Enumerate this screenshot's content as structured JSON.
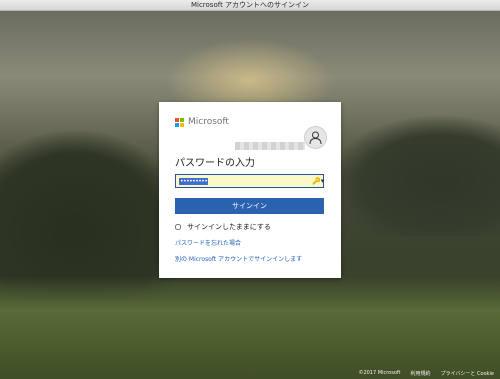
{
  "window": {
    "title": "Microsoft アカウントへのサインイン"
  },
  "brand": {
    "name": "Microsoft",
    "colors": {
      "red": "#f25022",
      "green": "#7fba00",
      "blue": "#00a4ef",
      "yellow": "#ffb900"
    }
  },
  "account": {
    "email": "",
    "avatar_icon": "user-icon"
  },
  "form": {
    "heading": "パスワードの入力",
    "password_value": "•••••••••",
    "signin_label": "サインイン",
    "keep_signed_in_label": "サインインしたままにする",
    "forgot_password_link": "パスワードを忘れた場合",
    "other_account_link": "別の Microsoft アカウントでサインインします",
    "button_color": "#2a62b0",
    "link_color": "#1f5fbf"
  },
  "footer": {
    "copyright": "©2017 Microsoft",
    "terms": "利用規約",
    "privacy": "プライバシーと Cookie"
  }
}
